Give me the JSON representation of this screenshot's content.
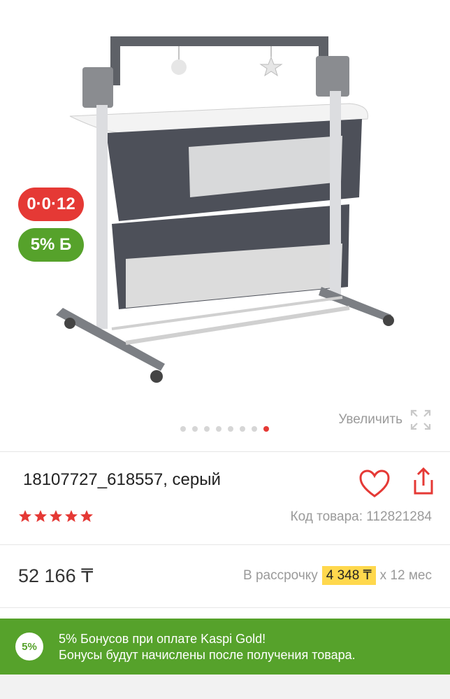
{
  "gallery": {
    "badges": {
      "installment": "0·0·12",
      "bonus": "5% Б"
    },
    "dots": {
      "count": 8,
      "active_index": 7
    },
    "zoom_label": "Увеличить"
  },
  "product": {
    "title": "18107727_618557, серый",
    "rating": 5,
    "sku_label": "Код товара: 112821284"
  },
  "price": {
    "value": "52 166 ₸",
    "installment_prefix": "В рассрочку",
    "installment_amount": "4 348 ₸",
    "installment_suffix": "x 12 мес"
  },
  "bonus": {
    "circle": "5%",
    "line1": "5% Бонусов при оплате Kaspi Gold!",
    "line2": "Бонусы будут начислены после получения товара."
  },
  "colors": {
    "red": "#e53935",
    "green": "#56a22b",
    "yellow": "#ffd84d"
  }
}
